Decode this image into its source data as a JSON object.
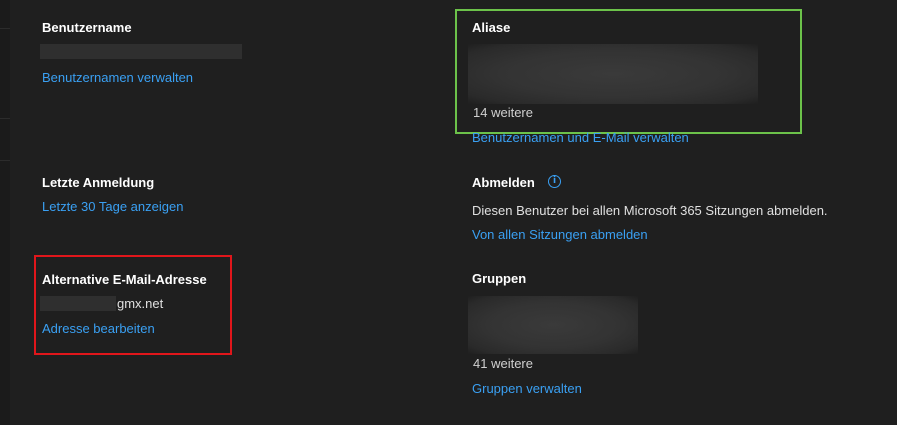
{
  "left": {
    "username": {
      "heading": "Benutzername",
      "manage_link": "Benutzernamen verwalten"
    },
    "last_login": {
      "heading": "Letzte Anmeldung",
      "show_link": "Letzte 30 Tage anzeigen"
    },
    "alt_email": {
      "heading": "Alternative E-Mail-Adresse",
      "domain_suffix": "gmx.net",
      "edit_link": "Adresse bearbeiten"
    }
  },
  "right": {
    "aliases": {
      "heading": "Aliase",
      "more": "14 weitere",
      "manage_link": "Benutzernamen und E-Mail verwalten"
    },
    "signout": {
      "heading": "Abmelden",
      "info_icon": "i",
      "description": "Diesen Benutzer bei allen Microsoft 365 Sitzungen abmelden.",
      "link": "Von allen Sitzungen abmelden"
    },
    "groups": {
      "heading": "Gruppen",
      "more": "41 weitere",
      "manage_link": "Gruppen verwalten"
    }
  },
  "colors": {
    "background": "#1f1f1f",
    "link": "#3aa0f3",
    "highlight_green": "#6cc24a",
    "highlight_red": "#e0161b"
  }
}
